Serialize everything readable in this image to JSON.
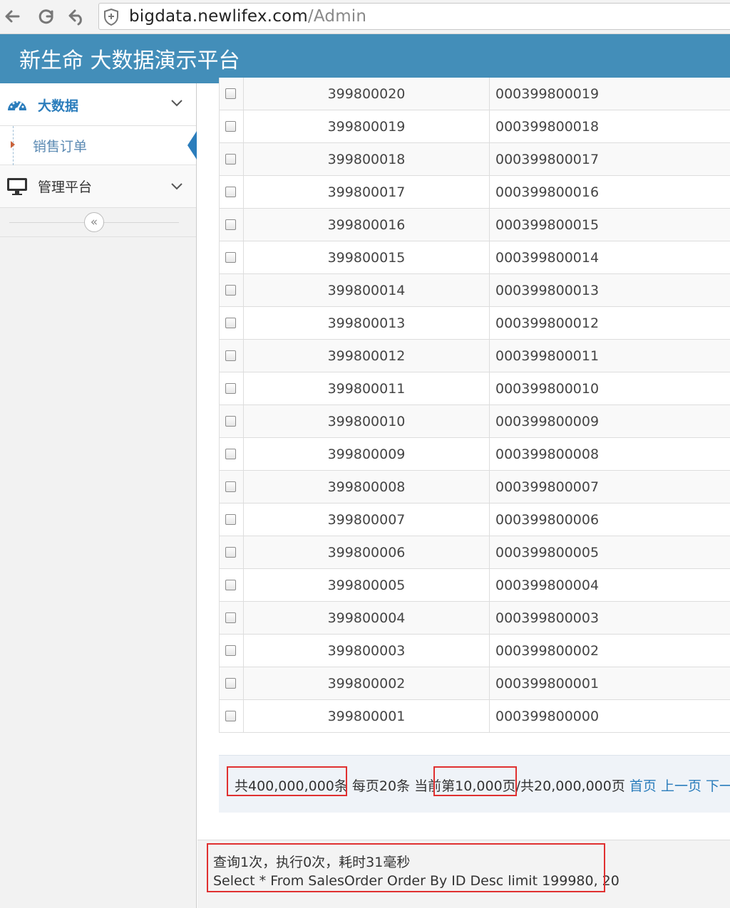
{
  "browser": {
    "url_host": "bigdata.newlifex.com",
    "url_path": "/Admin"
  },
  "header": {
    "title": "新生命 大数据演示平台"
  },
  "sidebar": {
    "items": [
      {
        "label": "大数据",
        "icon": "dashboard-icon"
      },
      {
        "label": "销售订单"
      },
      {
        "label": "管理平台",
        "icon": "desktop-icon"
      }
    ],
    "collapse_glyph": "«"
  },
  "table": {
    "rows": [
      {
        "id": "399800020",
        "order_no": "000399800019"
      },
      {
        "id": "399800019",
        "order_no": "000399800018"
      },
      {
        "id": "399800018",
        "order_no": "000399800017"
      },
      {
        "id": "399800017",
        "order_no": "000399800016"
      },
      {
        "id": "399800016",
        "order_no": "000399800015"
      },
      {
        "id": "399800015",
        "order_no": "000399800014"
      },
      {
        "id": "399800014",
        "order_no": "000399800013"
      },
      {
        "id": "399800013",
        "order_no": "000399800012"
      },
      {
        "id": "399800012",
        "order_no": "000399800011"
      },
      {
        "id": "399800011",
        "order_no": "000399800010"
      },
      {
        "id": "399800010",
        "order_no": "000399800009"
      },
      {
        "id": "399800009",
        "order_no": "000399800008"
      },
      {
        "id": "399800008",
        "order_no": "000399800007"
      },
      {
        "id": "399800007",
        "order_no": "000399800006"
      },
      {
        "id": "399800006",
        "order_no": "000399800005"
      },
      {
        "id": "399800005",
        "order_no": "000399800004"
      },
      {
        "id": "399800004",
        "order_no": "000399800003"
      },
      {
        "id": "399800003",
        "order_no": "000399800002"
      },
      {
        "id": "399800002",
        "order_no": "000399800001"
      },
      {
        "id": "399800001",
        "order_no": "000399800000"
      }
    ]
  },
  "pager": {
    "total": "共400,000,000条",
    "per_page": "每页20条",
    "current_prefix": "当前",
    "current": "第10,000页",
    "total_pages": "/共20,000,000页",
    "first": "首页",
    "prev": "上一页",
    "next": "下一"
  },
  "footer": {
    "stats": "查询1次，执行0次，耗时31毫秒",
    "sql": "Select * From SalesOrder Order By ID Desc limit 199980, 20"
  },
  "colors": {
    "header_bg": "#438eb9",
    "accent": "#2b7dbc",
    "highlight_box": "#e03030"
  }
}
